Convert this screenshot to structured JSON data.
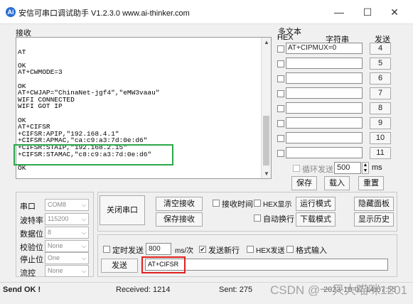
{
  "window": {
    "icon": "ai-thinker-logo-icon",
    "title": "安信可串口调试助手 V1.2.3.0    www.ai-thinker.com",
    "minimize": "—",
    "maximize": "☐",
    "close": "✕"
  },
  "receive": {
    "label": "接收",
    "lines": [
      "",
      "AT",
      "",
      "OK",
      "AT+CWMODE=3",
      "",
      "OK",
      "AT+CWJAP=\"ChinaNet-jgf4\",\"eMW3vaau\"",
      "WIFI CONNECTED",
      "WIFI GOT IP",
      "",
      "OK",
      "AT+CIFSR",
      "+CIFSR:APIP,\"192.168.4.1\"",
      "+CIFSR:APMAC,\"ca:c9:a3:7d:0e:d6\"",
      "+CIFSR:STAIP,\"192.168.2.15\"",
      "+CIFSR:STAMAC,\"c8:c9:a3:7d:0e:d6\"",
      "",
      "OK"
    ]
  },
  "multi_text": {
    "title": "多文本",
    "hex_col": "HEX",
    "string_col": "字符串",
    "send_col": "发送",
    "rows": [
      {
        "value": "AT+CIPMUX=0",
        "num": "4"
      },
      {
        "value": "",
        "num": "5"
      },
      {
        "value": "",
        "num": "6"
      },
      {
        "value": "",
        "num": "7"
      },
      {
        "value": "",
        "num": "8"
      },
      {
        "value": "",
        "num": "9"
      },
      {
        "value": "",
        "num": "10"
      },
      {
        "value": "",
        "num": "11"
      }
    ],
    "loop_label": "循环发送",
    "loop_value": "500",
    "loop_unit": "ms",
    "save": "保存",
    "load": "载入",
    "reset": "重置"
  },
  "serial": {
    "port_label": "串口",
    "port": "COM8",
    "baud_label": "波特率",
    "baud": "115200",
    "databits_label": "数据位",
    "databits": "8",
    "parity_label": "校验位",
    "parity": "None",
    "stopbits_label": "停止位",
    "stopbits": "One",
    "flow_label": "流控",
    "flow": "None"
  },
  "controls": {
    "close_port": "关闭串口",
    "clear_recv": "清空接收",
    "save_recv": "保存接收",
    "recv_time": "接收时间",
    "hex_display": "HEX显示",
    "auto_newline": "自动换行",
    "run_mode": "运行模式",
    "download_mode": "下载模式",
    "hide_panel": "隐藏面板",
    "show_history": "显示历史"
  },
  "send": {
    "timed_send": "定时发送",
    "interval": "800",
    "unit": "ms/次",
    "send_newline": "发送新行",
    "send_newline_checked": "✔",
    "hex_send": "HEX发送",
    "format_input": "格式输入",
    "send_button": "发送",
    "input": "AT+CIFSR"
  },
  "status": {
    "message": "Send OK !",
    "received": "Received: 1214",
    "sent": "Sent: 275",
    "time": "2023-10-07 14:07:55"
  },
  "watermark": "CSDN @一只大喵咪1201"
}
